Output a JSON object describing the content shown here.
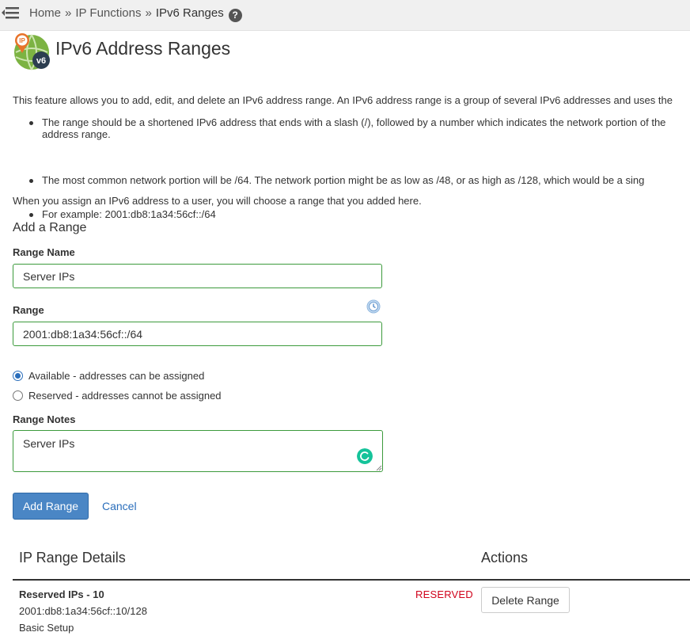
{
  "breadcrumb": {
    "items": [
      "Home",
      "IP Functions",
      "IPv6 Ranges"
    ],
    "separator": "»"
  },
  "page": {
    "title": "IPv6 Address Ranges",
    "icon_badge_top": "IP",
    "icon_badge_bottom": "v6"
  },
  "description": {
    "intro": "This feature allows you to add, edit, and delete an IPv6 address range. An IPv6 address range is a group of several IPv6 addresses and uses the",
    "bullets": [
      "The range should be a shortened IPv6 address that ends with a slash (/), followed by a number which indicates the network portion of the address range.",
      "The most common network portion will be /64. The network portion might be as low as /48, or as high as /128, which would be a sing",
      "For example: 2001:db8:1a34:56cf::/64"
    ],
    "outro": "When you assign an IPv6 address to a user, you will choose a range that you added here."
  },
  "form": {
    "section_title": "Add a Range",
    "range_name_label": "Range Name",
    "range_name_value": "Server IPs",
    "range_label": "Range",
    "range_value": "2001:db8:1a34:56cf::/64",
    "availability_options": [
      {
        "label": "Available - addresses can be assigned",
        "checked": true
      },
      {
        "label": "Reserved - addresses cannot be assigned",
        "checked": false
      }
    ],
    "notes_label": "Range Notes",
    "notes_value": "Server IPs",
    "submit_label": "Add Range",
    "cancel_label": "Cancel"
  },
  "table": {
    "headers": [
      "IP Range Details",
      "Actions"
    ],
    "rows": [
      {
        "name": "Reserved IPs - 10",
        "range": "2001:db8:1a34:56cf::10/128",
        "notes": "Basic Setup",
        "status": "RESERVED",
        "action_label": "Delete Range"
      }
    ]
  },
  "colors": {
    "accent": "#4a86c5",
    "input_border": "#3c9a3c",
    "status_reserved": "#d0021b",
    "link": "#2a6ebb"
  }
}
